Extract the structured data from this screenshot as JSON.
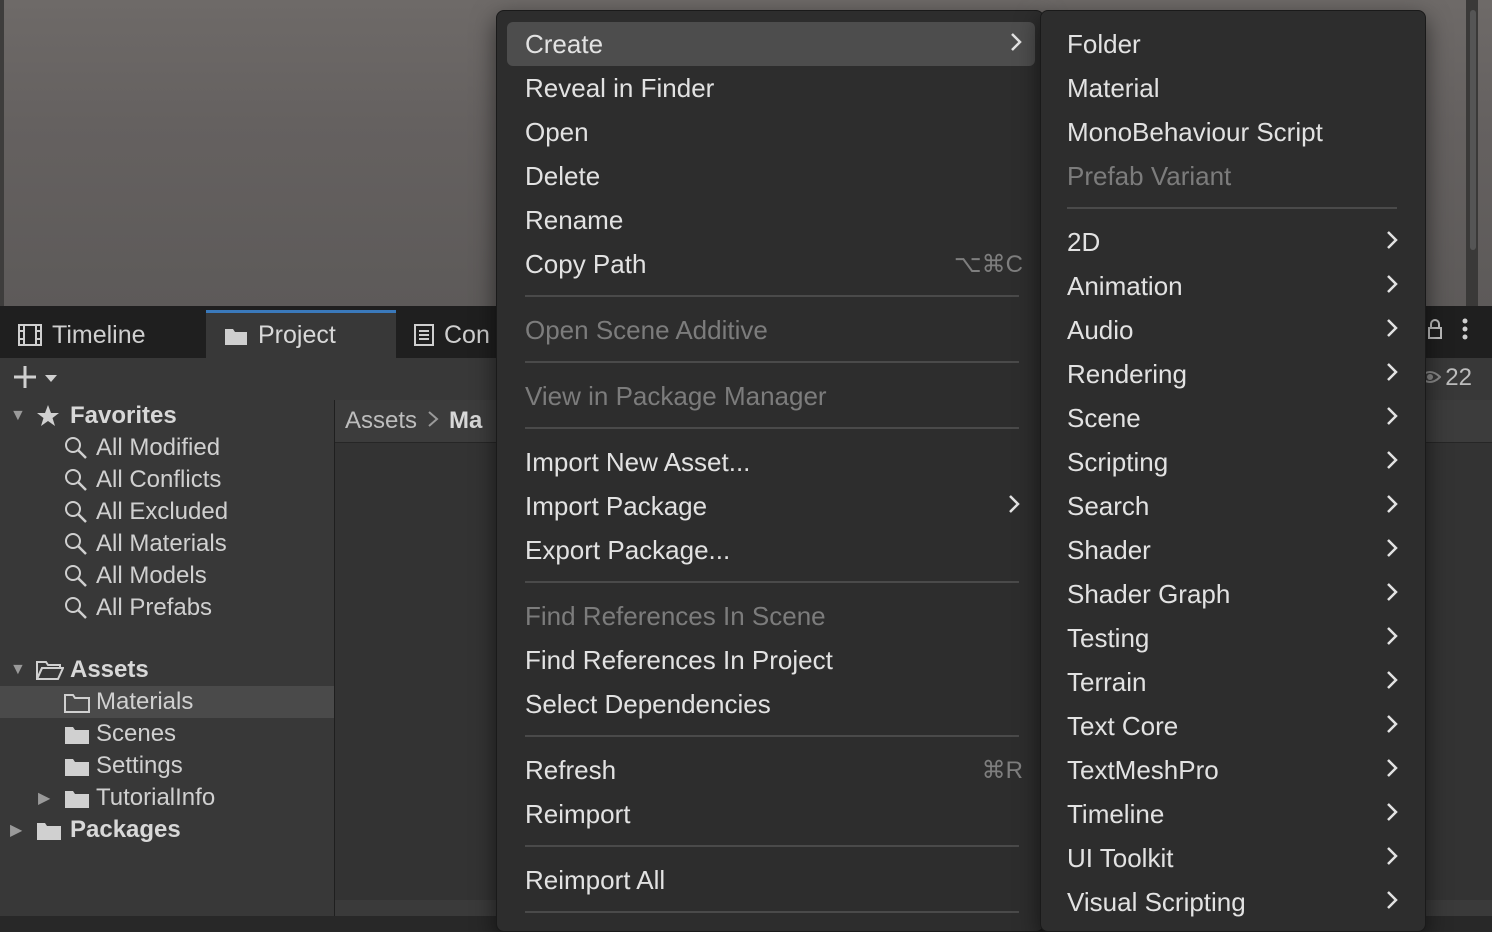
{
  "tabs": {
    "timeline": "Timeline",
    "project": "Project",
    "console": "Con"
  },
  "toolbar": {
    "hidden_count": "22"
  },
  "tree": {
    "favorites": "Favorites",
    "favorites_items": [
      "All Modified",
      "All Conflicts",
      "All Excluded",
      "All Materials",
      "All Models",
      "All Prefabs"
    ],
    "assets": "Assets",
    "assets_items": [
      "Materials",
      "Scenes",
      "Settings",
      "TutorialInfo"
    ],
    "packages": "Packages"
  },
  "breadcrumb": {
    "root": "Assets",
    "current": "Ma"
  },
  "context_menu": {
    "items": [
      {
        "label": "Create",
        "submenu": true
      },
      {
        "label": "Reveal in Finder"
      },
      {
        "label": "Open"
      },
      {
        "label": "Delete"
      },
      {
        "label": "Rename"
      },
      {
        "label": "Copy Path",
        "shortcut": "⌥⌘C"
      },
      {
        "label": "Open Scene Additive",
        "disabled": true
      },
      {
        "label": "View in Package Manager",
        "disabled": true
      },
      {
        "label": "Import New Asset..."
      },
      {
        "label": "Import Package",
        "submenu": true
      },
      {
        "label": "Export Package..."
      },
      {
        "label": "Find References In Scene",
        "disabled": true
      },
      {
        "label": "Find References In Project"
      },
      {
        "label": "Select Dependencies"
      },
      {
        "label": "Refresh",
        "shortcut": "⌘R"
      },
      {
        "label": "Reimport"
      },
      {
        "label": "Reimport All"
      }
    ]
  },
  "create_submenu": {
    "items": [
      {
        "label": "Folder"
      },
      {
        "label": "Material"
      },
      {
        "label": "MonoBehaviour Script"
      },
      {
        "label": "Prefab Variant",
        "disabled": true
      },
      {
        "label": "2D",
        "submenu": true
      },
      {
        "label": "Animation",
        "submenu": true
      },
      {
        "label": "Audio",
        "submenu": true
      },
      {
        "label": "Rendering",
        "submenu": true
      },
      {
        "label": "Scene",
        "submenu": true
      },
      {
        "label": "Scripting",
        "submenu": true
      },
      {
        "label": "Search",
        "submenu": true
      },
      {
        "label": "Shader",
        "submenu": true
      },
      {
        "label": "Shader Graph",
        "submenu": true
      },
      {
        "label": "Testing",
        "submenu": true
      },
      {
        "label": "Terrain",
        "submenu": true
      },
      {
        "label": "Text Core",
        "submenu": true
      },
      {
        "label": "TextMeshPro",
        "submenu": true
      },
      {
        "label": "Timeline",
        "submenu": true
      },
      {
        "label": "UI Toolkit",
        "submenu": true
      },
      {
        "label": "Visual Scripting",
        "submenu": true
      }
    ]
  },
  "colors": {
    "accent": "#3a79bb",
    "menu_bg": "#2d2d2d",
    "highlight": "#4d4d4d",
    "disabled_text": "#7c7c7c"
  }
}
